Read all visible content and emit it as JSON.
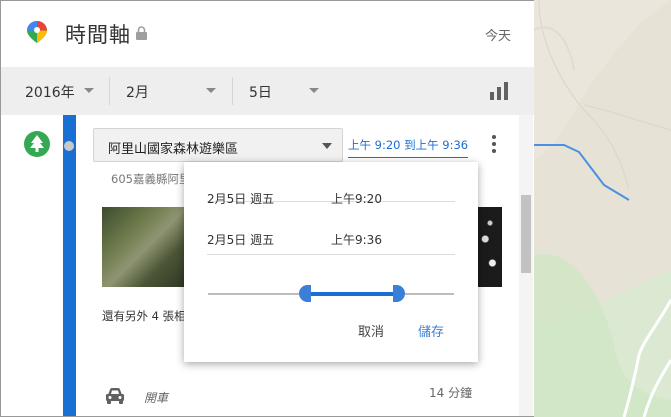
{
  "header": {
    "title": "時間軸",
    "today_label": "今天"
  },
  "date_filter": {
    "year": "2016年",
    "month": "2月",
    "day": "5日"
  },
  "place": {
    "name": "阿里山國家森林遊樂區",
    "time_range": "上午 9:20 到上午 9:36",
    "address": "605嘉義縣阿里",
    "more_photos": "還有另外 4 張相"
  },
  "editor": {
    "start_date": "2月5日 週五",
    "start_time": "上午9:20",
    "end_date": "2月5日 週五",
    "end_time": "上午9:36",
    "cancel_label": "取消",
    "save_label": "儲存",
    "range_start_fraction": 0.41,
    "range_end_fraction": 0.76
  },
  "segment": {
    "mode": "開車",
    "duration": "14 分鐘"
  },
  "colors": {
    "accent": "#1a6fd3",
    "tree_badge": "#34a853",
    "datebar_bg": "#eeeeee"
  }
}
